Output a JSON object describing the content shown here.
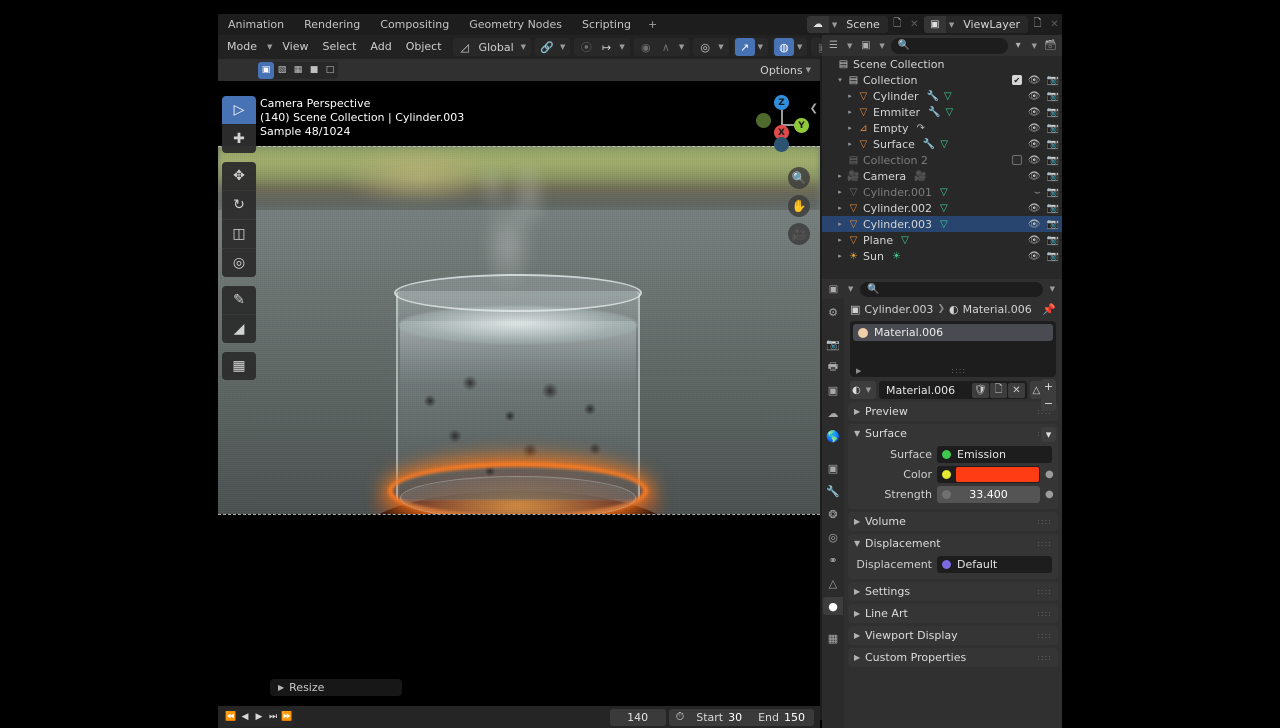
{
  "topbar": {
    "workspace_tabs": [
      "Animation",
      "Rendering",
      "Compositing",
      "Geometry Nodes",
      "Scripting"
    ],
    "add_tab": "+",
    "scene_name": "Scene",
    "viewlayer_name": "ViewLayer"
  },
  "viewport_header": {
    "mode": "Mode",
    "menus": [
      "View",
      "Select",
      "Add",
      "Object"
    ],
    "transform_orientation": "Global",
    "options": "Options"
  },
  "viewport": {
    "overlay_line1": "Camera Perspective",
    "overlay_line2": "(140) Scene Collection | Cylinder.003",
    "overlay_line3": "Sample 48/1024",
    "gizmo_axes": [
      "Z",
      "Y",
      "X"
    ],
    "resize_panel": "Resize"
  },
  "timeline": {
    "current_frame": "140",
    "start_label": "Start",
    "start_value": "30",
    "end_label": "End",
    "end_value": "150"
  },
  "outliner": {
    "rows": [
      {
        "name": "Scene Collection",
        "icon": "collection-icon",
        "indent": 0,
        "disclosure": "",
        "selected": false,
        "dim": false,
        "checkbox": null,
        "badges": [],
        "eye": false,
        "camera": false
      },
      {
        "name": "Collection",
        "icon": "collection-icon",
        "indent": 1,
        "disclosure": "▾",
        "selected": false,
        "dim": false,
        "checkbox": "on",
        "badges": [],
        "eye": true,
        "camera": true
      },
      {
        "name": "Cylinder",
        "icon": "mesh-icon",
        "indent": 2,
        "disclosure": "▸",
        "selected": false,
        "dim": false,
        "checkbox": null,
        "badges": [
          "modifier-icon",
          "mesh-data-icon"
        ],
        "eye": true,
        "camera": true
      },
      {
        "name": "Emmiter",
        "icon": "mesh-icon",
        "indent": 2,
        "disclosure": "▸",
        "selected": false,
        "dim": false,
        "checkbox": null,
        "badges": [
          "modifier-icon",
          "mesh-data-icon"
        ],
        "eye": true,
        "camera": true
      },
      {
        "name": "Empty",
        "icon": "empty-icon",
        "indent": 2,
        "disclosure": "▸",
        "selected": false,
        "dim": false,
        "checkbox": null,
        "badges": [
          "constraint-icon"
        ],
        "eye": true,
        "camera": true
      },
      {
        "name": "Surface",
        "icon": "mesh-icon",
        "indent": 2,
        "disclosure": "▸",
        "selected": false,
        "dim": false,
        "checkbox": null,
        "badges": [
          "modifier-icon",
          "mesh-data-icon"
        ],
        "eye": true,
        "camera": true
      },
      {
        "name": "Collection 2",
        "icon": "collection-icon",
        "indent": 1,
        "disclosure": "",
        "selected": false,
        "dim": true,
        "checkbox": "off",
        "badges": [],
        "eye": true,
        "camera": true
      },
      {
        "name": "Camera",
        "icon": "camera-icon",
        "indent": 1,
        "disclosure": "▸",
        "selected": false,
        "dim": false,
        "checkbox": null,
        "badges": [
          "camera-data-icon"
        ],
        "eye": true,
        "camera": true
      },
      {
        "name": "Cylinder.001",
        "icon": "mesh-icon",
        "indent": 1,
        "disclosure": "▸",
        "selected": false,
        "dim": true,
        "checkbox": null,
        "badges": [
          "mesh-data-icon"
        ],
        "eye": false,
        "camera": true
      },
      {
        "name": "Cylinder.002",
        "icon": "mesh-icon",
        "indent": 1,
        "disclosure": "▸",
        "selected": false,
        "dim": false,
        "checkbox": null,
        "badges": [
          "mesh-data-icon"
        ],
        "eye": true,
        "camera": true
      },
      {
        "name": "Cylinder.003",
        "icon": "mesh-icon",
        "indent": 1,
        "disclosure": "▸",
        "selected": true,
        "dim": false,
        "checkbox": null,
        "badges": [
          "mesh-data-icon"
        ],
        "eye": true,
        "camera": true
      },
      {
        "name": "Plane",
        "icon": "mesh-icon",
        "indent": 1,
        "disclosure": "▸",
        "selected": false,
        "dim": false,
        "checkbox": null,
        "badges": [
          "mesh-data-icon"
        ],
        "eye": true,
        "camera": true
      },
      {
        "name": "Sun",
        "icon": "light-icon",
        "indent": 1,
        "disclosure": "▸",
        "selected": false,
        "dim": false,
        "checkbox": null,
        "badges": [
          "light-data-icon"
        ],
        "eye": true,
        "camera": true
      }
    ]
  },
  "properties": {
    "breadcrumb_object": "Cylinder.003",
    "breadcrumb_material": "Material.006",
    "material_slot": "Material.006",
    "material_name_field": "Material.006",
    "panels": [
      {
        "label": "Preview",
        "open": false
      },
      {
        "label": "Surface",
        "open": true
      },
      {
        "label": "Volume",
        "open": false
      },
      {
        "label": "Displacement",
        "open": true
      },
      {
        "label": "Settings",
        "open": false
      },
      {
        "label": "Line Art",
        "open": false
      },
      {
        "label": "Viewport Display",
        "open": false
      },
      {
        "label": "Custom Properties",
        "open": false
      }
    ],
    "surface": {
      "surface_label": "Surface",
      "surface_value": "Emission",
      "color_label": "Color",
      "color_value": "#ff3c14",
      "strength_label": "Strength",
      "strength_value": "33.400"
    },
    "displacement": {
      "label": "Displacement",
      "value": "Default"
    }
  },
  "colors": {
    "accent_blue": "#4772b3",
    "selected_row": "#27456e",
    "emission_orange": "#ff3c14",
    "mesh_orange": "#e08a3c"
  }
}
